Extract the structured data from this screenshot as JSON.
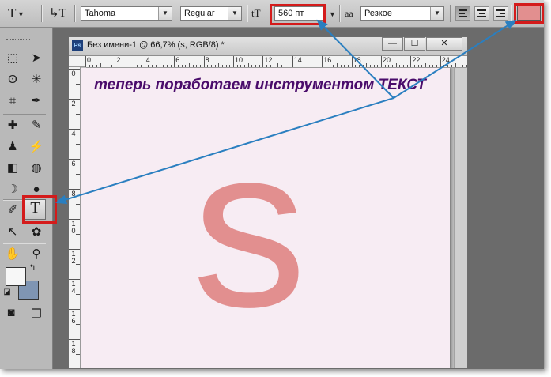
{
  "options_bar": {
    "tool_glyph": "T",
    "orient_glyph": "↳T",
    "font_family": "Tahoma",
    "font_style": "Regular",
    "size_glyph": "tT",
    "font_size": "560 пт",
    "aa_glyph": "aa",
    "antialias": "Резкое",
    "dropdown_arrow": "▼",
    "text_color": "#e28f8f"
  },
  "document": {
    "title": "Без имени-1 @ 66,7% (s, RGB/8) *",
    "ps_badge": "Ps",
    "min_glyph": "—",
    "max_glyph": "☐",
    "close_glyph": "✕",
    "ruler_top_labels": [
      "0",
      "2",
      "4",
      "6",
      "8",
      "10",
      "12",
      "14",
      "16",
      "18",
      "20",
      "22",
      "24"
    ],
    "ruler_left_labels": [
      "0",
      "2",
      "4",
      "6",
      "8",
      "1\n0",
      "1\n2",
      "1\n4",
      "1\n6",
      "1\n8"
    ],
    "canvas_text": "теперь поработаем инструментом ТЕКСТ",
    "big_letter": "s",
    "canvas_color": "#f7ecf3",
    "letter_color": "#e28f8f"
  },
  "tools": {
    "type_tool_glyph": "T"
  },
  "highlight_color": "#d41b1b",
  "arrow_color": "#2a7fc0"
}
